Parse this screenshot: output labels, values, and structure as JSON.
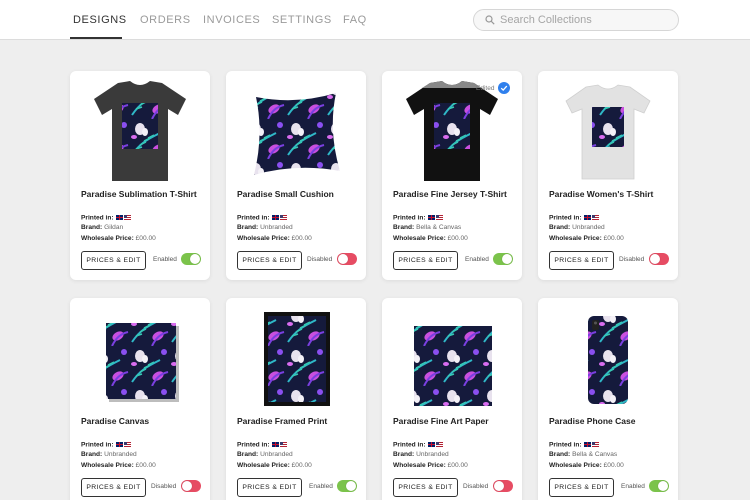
{
  "nav": {
    "tabs": [
      {
        "label": "DESIGNS",
        "active": true
      },
      {
        "label": "ORDERS"
      },
      {
        "label": "INVOICES"
      },
      {
        "label": "SETTINGS"
      },
      {
        "label": "FAQ"
      }
    ],
    "search": {
      "placeholder": "Search Collections",
      "value": "",
      "icon": "search-icon"
    }
  },
  "labels": {
    "printed_in": "Printed in:",
    "brand": "Brand:",
    "wholesale_price": "Wholesale Price:",
    "button": "PRICES & EDIT",
    "enabled": "Enabled",
    "disabled": "Disabled",
    "edited": "Edited"
  },
  "colors": {
    "toggle_on": "#7bc34b",
    "toggle_off": "#e64c63",
    "edited_badge": "#2f80ed"
  },
  "products": [
    {
      "title": "Paradise Sublimation T-Shirt",
      "brand": "Gildan",
      "price": "£00.00",
      "status": "Enabled",
      "enabled": true,
      "image": "dark-tshirt"
    },
    {
      "title": "Paradise Small Cushion",
      "brand": "Unbranded",
      "price": "£00.00",
      "status": "Disabled",
      "enabled": false,
      "image": "cushion"
    },
    {
      "title": "Paradise Fine Jersey T-Shirt",
      "brand": "Bella & Canvas",
      "price": "£00.00",
      "status": "Enabled",
      "enabled": true,
      "edited": true,
      "image": "black-tshirt"
    },
    {
      "title": "Paradise Women's T-Shirt",
      "brand": "Unbranded",
      "price": "£00.00",
      "status": "Disabled",
      "enabled": false,
      "image": "white-tshirt"
    },
    {
      "title": "Paradise Canvas",
      "brand": "Unbranded",
      "price": "£00.00",
      "status": "Disabled",
      "enabled": false,
      "image": "canvas"
    },
    {
      "title": "Paradise Framed Print",
      "brand": "Unbranded",
      "price": "£00.00",
      "status": "Enabled",
      "enabled": true,
      "image": "framed-print"
    },
    {
      "title": "Paradise Fine Art Paper",
      "brand": "Unbranded",
      "price": "£00.00",
      "status": "Disabled",
      "enabled": false,
      "image": "art-paper"
    },
    {
      "title": "Paradise Phone Case",
      "brand": "Bella & Canvas",
      "price": "£00.00",
      "status": "Enabled",
      "enabled": true,
      "image": "phone-case"
    }
  ]
}
